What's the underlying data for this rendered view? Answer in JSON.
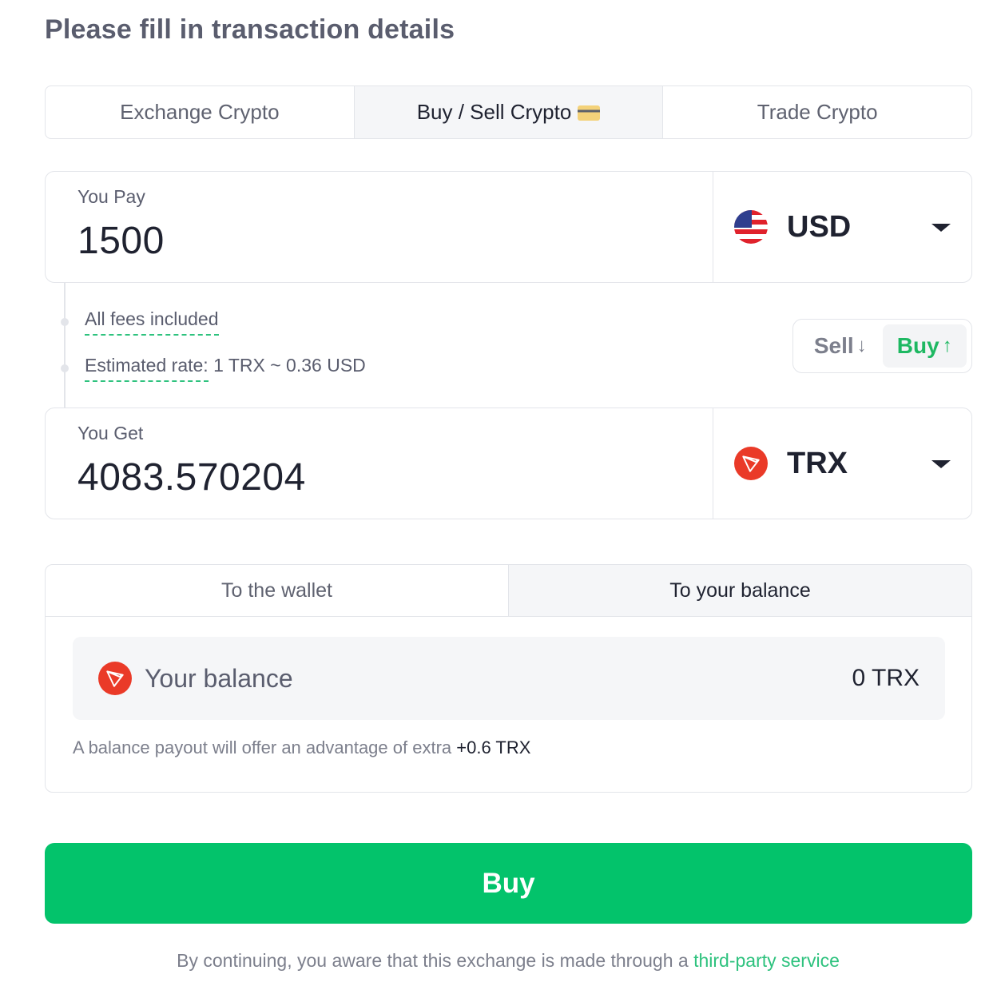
{
  "page_title": "Please fill in transaction details",
  "tabs": [
    {
      "label": "Exchange Crypto",
      "active": false
    },
    {
      "label": "Buy / Sell Crypto",
      "active": true,
      "icon": "credit-card-icon"
    },
    {
      "label": "Trade Crypto",
      "active": false
    }
  ],
  "pay": {
    "label": "You Pay",
    "value": "1500",
    "currency": "USD",
    "icon": "us-flag-icon"
  },
  "fees": {
    "included_label": "All fees included",
    "rate_label": "Estimated rate:",
    "rate_value": "1 TRX ~ 0.36 USD"
  },
  "toggle": {
    "sell_label": "Sell",
    "buy_label": "Buy",
    "sell_arrow": "↓",
    "buy_arrow": "↑",
    "selected": "Buy"
  },
  "get": {
    "label": "You Get",
    "value": "4083.570204",
    "currency": "TRX",
    "icon": "tron-icon"
  },
  "destination": {
    "tabs": [
      {
        "label": "To the wallet",
        "active": false
      },
      {
        "label": "To your balance",
        "active": true
      }
    ],
    "balance_label": "Your balance",
    "balance_value": "0 TRX",
    "advantage_text": "A balance payout will offer an advantage of extra",
    "advantage_value": "+0.6 TRX"
  },
  "buy_button_label": "Buy",
  "disclaimer": {
    "text": "By continuing, you aware that this exchange is made through a",
    "link": "third-party service"
  },
  "colors": {
    "accent_green": "#03c36b",
    "buy_green": "#1eb862",
    "link_green": "#2ec27e",
    "tron_red": "#ea3a28"
  }
}
